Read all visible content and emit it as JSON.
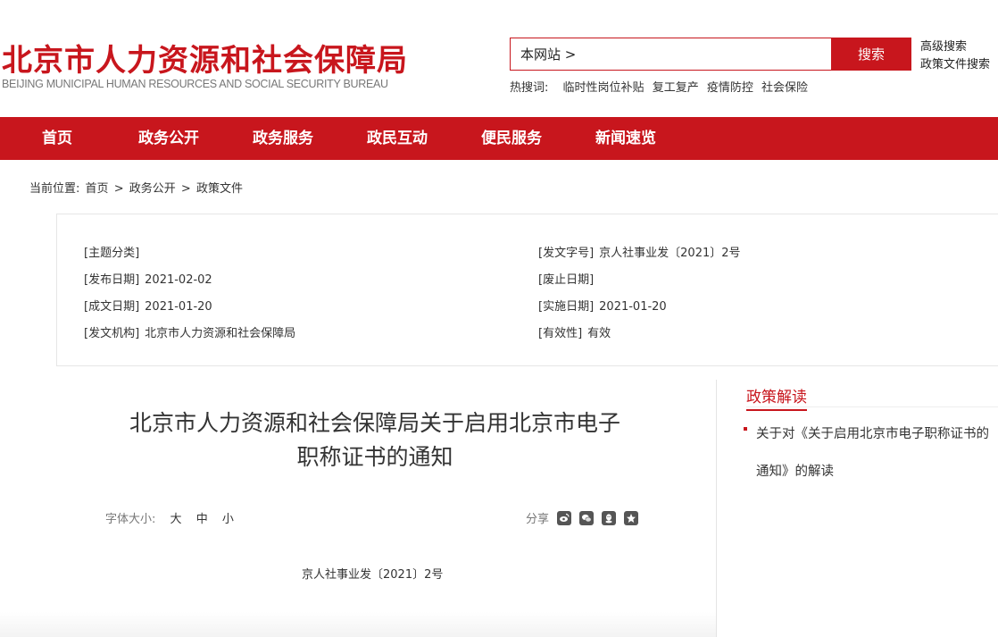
{
  "header": {
    "logo_cn": "北京市人力资源和社会保障局",
    "logo_en": "BEIJING MUNICIPAL HUMAN RESOURCES AND SOCIAL SECURITY BUREAU",
    "search_value": "本网站 >",
    "search_button": "搜索",
    "advanced_search": "高级搜索",
    "policy_search": "政策文件搜索",
    "hotwords_label": "热搜词:",
    "hotwords": [
      "临时性岗位补贴",
      "复工复产",
      "疫情防控",
      "社会保险"
    ]
  },
  "nav": {
    "items": [
      "首页",
      "政务公开",
      "政务服务",
      "政民互动",
      "便民服务",
      "新闻速览"
    ]
  },
  "breadcrumb": {
    "label": "当前位置:",
    "items": [
      "首页",
      "政务公开",
      "政策文件"
    ],
    "separator": ">"
  },
  "meta": {
    "topic_label": "[主题分类]",
    "topic_value": "",
    "doc_no_label": "[发文字号]",
    "doc_no_value": "京人社事业发〔2021〕2号",
    "publish_label": "[发布日期]",
    "publish_value": "2021-02-02",
    "abolish_label": "[废止日期]",
    "abolish_value": "",
    "written_label": "[成文日期]",
    "written_value": "2021-01-20",
    "effective_label": "[实施日期]",
    "effective_value": "2021-01-20",
    "issuer_label": "[发文机构]",
    "issuer_value": "北京市人力资源和社会保障局",
    "validity_label": "[有效性]",
    "validity_value": "有效"
  },
  "article": {
    "title_line1": "北京市人力资源和社会保障局关于启用北京市电子",
    "title_line2": "职称证书的通知",
    "font_size_label": "字体大小:",
    "font_sizes": [
      "大",
      "中",
      "小"
    ],
    "share_label": "分享",
    "doc_number": "京人社事业发〔2021〕2号"
  },
  "sidebar": {
    "title": "政策解读",
    "link": "关于对《关于启用北京市电子职称证书的通知》的解读"
  },
  "colors": {
    "brand_red": "#c8161d"
  },
  "icons": {
    "share": [
      "weibo-icon",
      "wechat-icon",
      "qq-icon",
      "qzone-icon"
    ]
  }
}
